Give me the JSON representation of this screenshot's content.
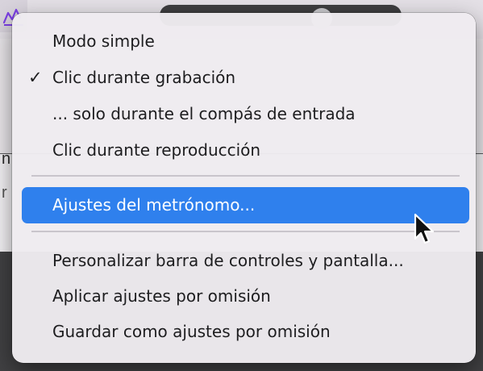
{
  "menu": {
    "items": [
      {
        "label": "Modo simple",
        "checked": false
      },
      {
        "label": "Clic durante grabación",
        "checked": true,
        "check_glyph": "✓"
      },
      {
        "label": "... solo durante el compás de entrada",
        "checked": false
      },
      {
        "label": "Clic durante reproducción",
        "checked": false
      },
      {
        "label": "Ajustes del metrónomo...",
        "checked": false,
        "highlighted": true
      },
      {
        "label": "Personalizar barra de controles y pantalla...",
        "checked": false
      },
      {
        "label": "Aplicar ajustes por omisión",
        "checked": false
      },
      {
        "label": "Guardar como ajustes por omisión",
        "checked": false
      }
    ]
  },
  "background": {
    "edge_text_1": "n",
    "edge_text_2": "r"
  },
  "colors": {
    "highlight": "#2f80ed",
    "menu_background": "#eeebf0",
    "accent_icon": "#7b3fe4"
  },
  "icons": {
    "toolbar_icon": "purple-control-bar-icon",
    "pointer": "arrow-cursor-icon"
  }
}
